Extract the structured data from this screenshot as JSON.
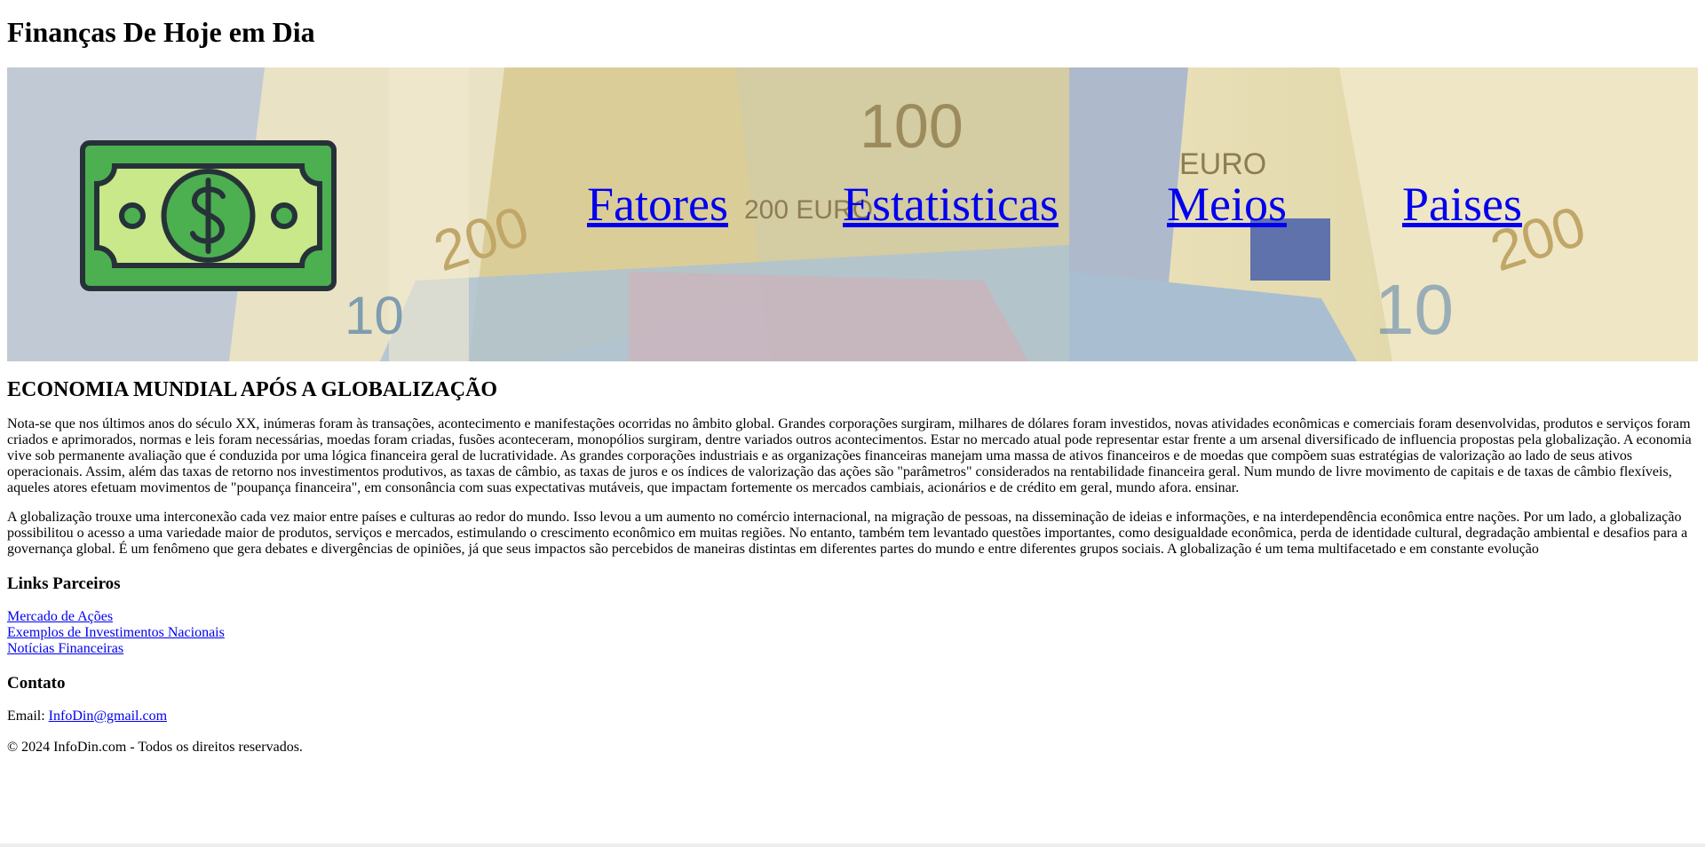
{
  "header": {
    "title": "Finanças De Hoje em Dia"
  },
  "banner": {
    "logo_icon": "money-bill-icon",
    "nav": [
      {
        "label": "Fatores"
      },
      {
        "label": "Estatisticas"
      },
      {
        "label": "Meios"
      },
      {
        "label": "Paises"
      }
    ]
  },
  "main": {
    "heading": "ECONOMIA MUNDIAL APÓS A GLOBALIZAÇÃO",
    "paragraphs": [
      "Nota-se que nos últimos anos do século XX, inúmeras foram às transações, acontecimento e manifestações ocorridas no âmbito global. Grandes corporações surgiram, milhares de dólares foram investidos, novas atividades econômicas e comerciais foram desenvolvidas, produtos e serviços foram criados e aprimorados, normas e leis foram necessárias, moedas foram criadas, fusões aconteceram, monopólios surgiram, dentre variados outros acontecimentos. Estar no mercado atual pode representar estar frente a um arsenal diversificado de influencia propostas pela globalização. A economia vive sob permanente avaliação que é conduzida por uma lógica financeira geral de lucratividade. As grandes corporações industriais e as organizações financeiras manejam uma massa de ativos financeiros e de moedas que compõem suas estratégias de valorização ao lado de seus ativos operacionais. Assim, além das taxas de retorno nos investimentos produtivos, as taxas de câmbio, as taxas de juros e os índices de valorização das ações são \"parâmetros\" considerados na rentabilidade financeira geral. Num mundo de livre movimento de capitais e de taxas de câmbio flexíveis, aqueles atores efetuam movimentos de \"poupança financeira\", em consonância com suas expectativas mutáveis, que impactam fortemente os mercados cambiais, acionários e de crédito em geral, mundo afora. ensinar.",
      "A globalização trouxe uma interconexão cada vez maior entre países e culturas ao redor do mundo. Isso levou a um aumento no comércio internacional, na migração de pessoas, na disseminação de ideias e informações, e na interdependência econômica entre nações. Por um lado, a globalização possibilitou o acesso a uma variedade maior de produtos, serviços e mercados, estimulando o crescimento econômico em muitas regiões. No entanto, também tem levantado questões importantes, como desigualdade econômica, perda de identidade cultural, degradação ambiental e desafios para a governança global. É um fenômeno que gera debates e divergências de opiniões, já que seus impactos são percebidos de maneiras distintas em diferentes partes do mundo e entre diferentes grupos sociais. A globalização é um tema multifacetado e em constante evolução"
    ]
  },
  "partners": {
    "heading": "Links Parceiros",
    "links": [
      {
        "label": "Mercado de Ações"
      },
      {
        "label": "Exemplos de Investimentos Nacionais"
      },
      {
        "label": "Notícias Financeiras"
      }
    ]
  },
  "contact": {
    "heading": "Contato",
    "email_label": "Email: ",
    "email": "InfoDin@gmail.com"
  },
  "footer": {
    "copyright": "© 2024 InfoDin.com - Todos os direitos reservados."
  },
  "colors": {
    "link": "#0000ee",
    "bill_green": "#4caf50",
    "bill_light": "#c8e88a",
    "bill_outline": "#263238"
  }
}
